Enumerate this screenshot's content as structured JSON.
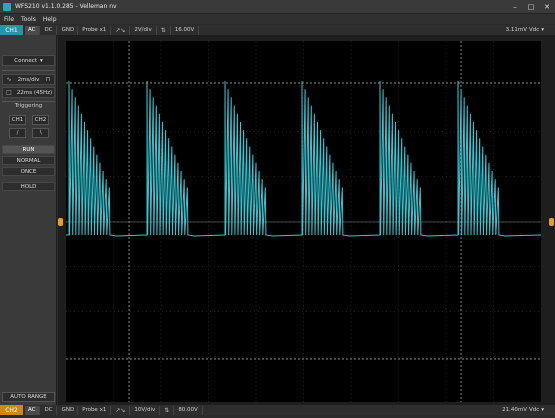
{
  "window": {
    "title": "WFS210 v1.1.0.285 - Velleman nv"
  },
  "menu": [
    "File",
    "Tools",
    "Help"
  ],
  "ch1": {
    "label": "CH1",
    "coupling_buttons": [
      "AC",
      "DC",
      "GND"
    ],
    "active_coupling": "AC",
    "probe": "Probe x1",
    "volts_div": "2V/div",
    "offset": "16.00V",
    "measure": "3.11mV",
    "measure_mode": "Vdc"
  },
  "ch2": {
    "label": "CH2",
    "coupling_buttons": [
      "AC",
      "DC",
      "GND"
    ],
    "active_coupling": "AC",
    "probe": "Probe x1",
    "volts_div": "10V/div",
    "offset": "80.00V",
    "measure": "21.40mV",
    "measure_mode": "Vdc"
  },
  "sidebar": {
    "connect": "Connect",
    "timebase": "2ms/div",
    "frequency": "22ms (45Hz)",
    "triggering": "Triggering",
    "trig_ch1": "CH1",
    "trig_ch2": "CH2",
    "modes": [
      "RUN",
      "NORMAL",
      "ONCE",
      "HOLD"
    ],
    "active_mode": "RUN",
    "autorange": "AUTO RANGE"
  },
  "colors": {
    "ch1_trace": "#32c8d6",
    "ch1_badge": "#2b93a6",
    "ch2_badge": "#c98a16",
    "marker": "#e7a121"
  }
}
